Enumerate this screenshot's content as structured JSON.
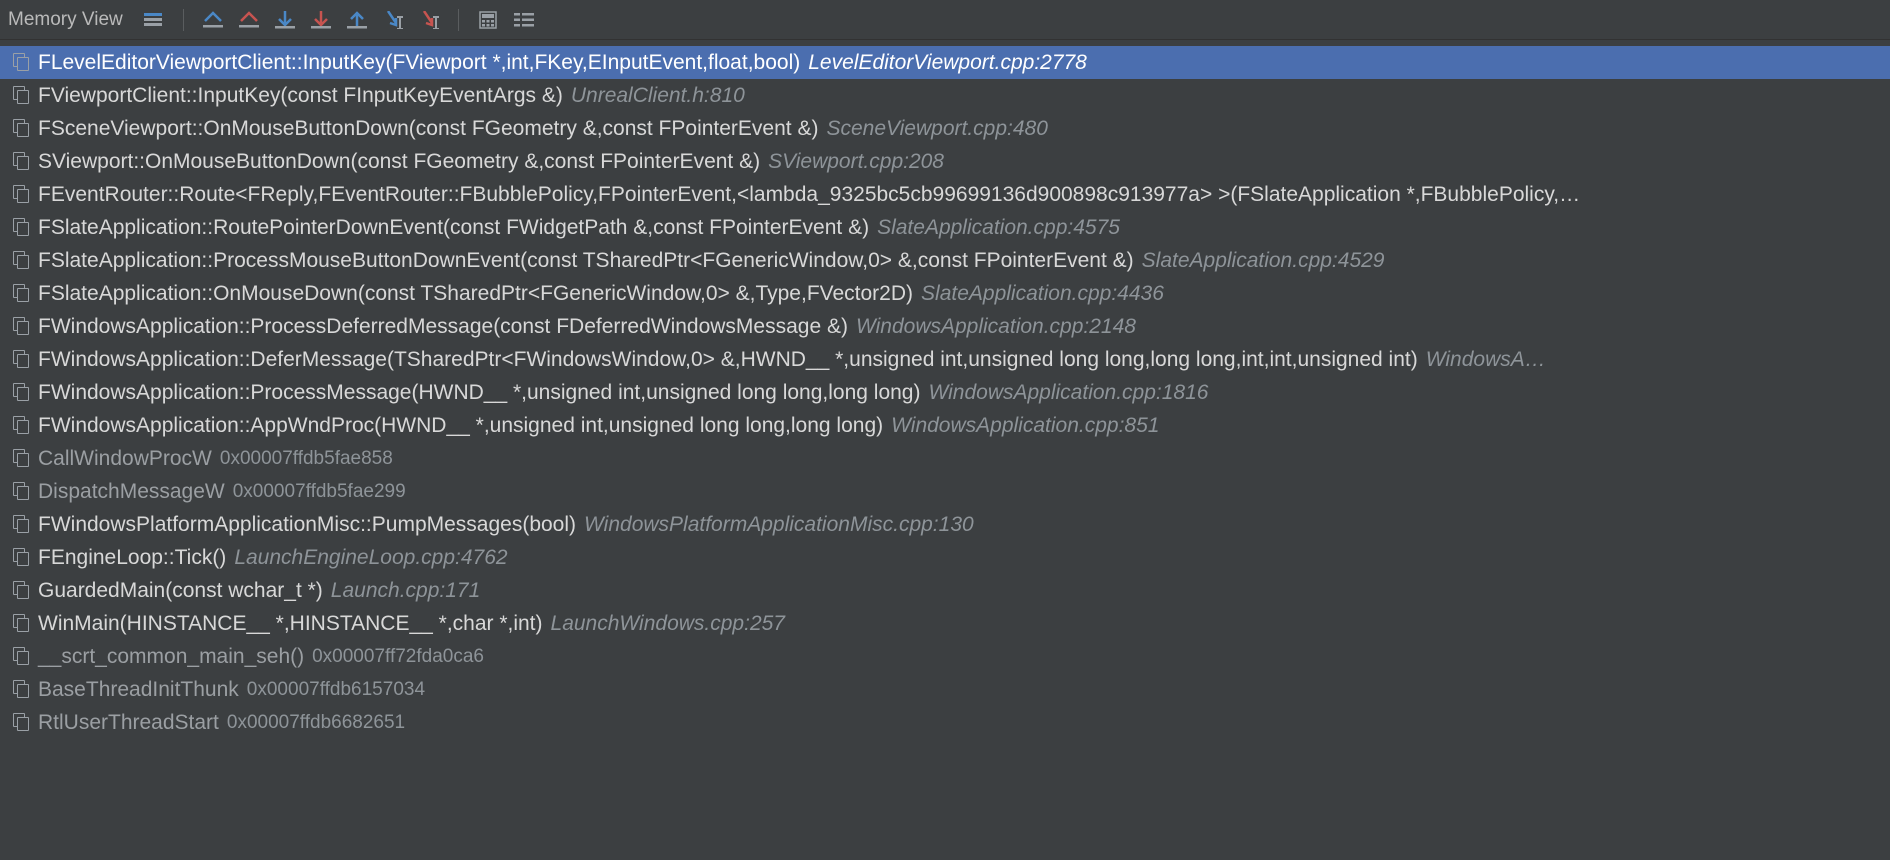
{
  "toolbar": {
    "memory_view_label": "Memory View"
  },
  "frames": [
    {
      "fn": "FLevelEditorViewportClient::InputKey(FViewport *,int,FKey,EInputEvent,float,bool)",
      "loc": "LevelEditorViewport.cpp:2778",
      "selected": true
    },
    {
      "fn": "FViewportClient::InputKey(const FInputKeyEventArgs &)",
      "loc": "UnrealClient.h:810"
    },
    {
      "fn": "FSceneViewport::OnMouseButtonDown(const FGeometry &,const FPointerEvent &)",
      "loc": "SceneViewport.cpp:480"
    },
    {
      "fn": "SViewport::OnMouseButtonDown(const FGeometry &,const FPointerEvent &)",
      "loc": "SViewport.cpp:208"
    },
    {
      "fn": "FEventRouter::Route<FReply,FEventRouter::FBubblePolicy,FPointerEvent,<lambda_9325bc5cb99699136d900898c913977a> >(FSlateApplication *,FBubblePolicy,…",
      "loc": ""
    },
    {
      "fn": "FSlateApplication::RoutePointerDownEvent(const FWidgetPath &,const FPointerEvent &)",
      "loc": "SlateApplication.cpp:4575"
    },
    {
      "fn": "FSlateApplication::ProcessMouseButtonDownEvent(const TSharedPtr<FGenericWindow,0> &,const FPointerEvent &)",
      "loc": "SlateApplication.cpp:4529"
    },
    {
      "fn": "FSlateApplication::OnMouseDown(const TSharedPtr<FGenericWindow,0> &,Type,FVector2D)",
      "loc": "SlateApplication.cpp:4436"
    },
    {
      "fn": "FWindowsApplication::ProcessDeferredMessage(const FDeferredWindowsMessage &)",
      "loc": "WindowsApplication.cpp:2148"
    },
    {
      "fn": "FWindowsApplication::DeferMessage(TSharedPtr<FWindowsWindow,0> &,HWND__ *,unsigned int,unsigned long long,long long,int,int,unsigned int)",
      "loc": "WindowsA…"
    },
    {
      "fn": "FWindowsApplication::ProcessMessage(HWND__ *,unsigned int,unsigned long long,long long)",
      "loc": "WindowsApplication.cpp:1816"
    },
    {
      "fn": "FWindowsApplication::AppWndProc(HWND__ *,unsigned int,unsigned long long,long long)",
      "loc": "WindowsApplication.cpp:851"
    },
    {
      "fn": "CallWindowProcW",
      "addr": "0x00007ffdb5fae858",
      "dim": true
    },
    {
      "fn": "DispatchMessageW",
      "addr": "0x00007ffdb5fae299",
      "dim": true
    },
    {
      "fn": "FWindowsPlatformApplicationMisc::PumpMessages(bool)",
      "loc": "WindowsPlatformApplicationMisc.cpp:130"
    },
    {
      "fn": "FEngineLoop::Tick()",
      "loc": "LaunchEngineLoop.cpp:4762"
    },
    {
      "fn": "GuardedMain(const wchar_t *)",
      "loc": "Launch.cpp:171"
    },
    {
      "fn": "WinMain(HINSTANCE__ *,HINSTANCE__ *,char *,int)",
      "loc": "LaunchWindows.cpp:257"
    },
    {
      "fn": "__scrt_common_main_seh()",
      "addr": "0x00007ff72fda0ca6",
      "dim": true
    },
    {
      "fn": "BaseThreadInitThunk",
      "addr": "0x00007ffdb6157034",
      "dim": true
    },
    {
      "fn": "RtlUserThreadStart",
      "addr": "0x00007ffdb6682651",
      "dim": true
    }
  ]
}
